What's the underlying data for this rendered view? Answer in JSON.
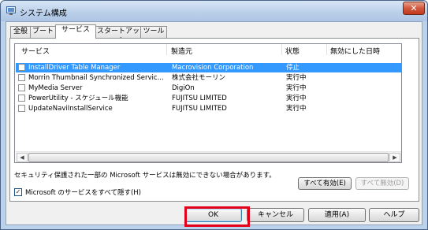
{
  "window": {
    "title": "システム構成",
    "close_symbol": "✕"
  },
  "tabs": [
    {
      "label": "全般"
    },
    {
      "label": "ブート"
    },
    {
      "label": "サービス"
    },
    {
      "label": "スタートアップ"
    },
    {
      "label": "ツール"
    }
  ],
  "active_tab": "サービス",
  "columns": [
    "サービス",
    "製造元",
    "状態",
    "無効にした日時"
  ],
  "services": [
    {
      "name": "InstallDriver Table Manager",
      "maker": "Macrovision Corporation",
      "status": "停止",
      "disabled_date": "",
      "checked": false,
      "selected": true
    },
    {
      "name": "Morrin Thumbnail Synchronized Servic...",
      "maker": "株式会社モーリン",
      "status": "実行中",
      "disabled_date": "",
      "checked": false,
      "selected": false
    },
    {
      "name": "MyMedia Server",
      "maker": "DigiOn",
      "status": "実行中",
      "disabled_date": "",
      "checked": false,
      "selected": false
    },
    {
      "name": "PowerUtility - スケジュール機能",
      "maker": "FUJITSU LIMITED",
      "status": "実行中",
      "disabled_date": "",
      "checked": false,
      "selected": false
    },
    {
      "name": "UpdateNaviInstallService",
      "maker": "FUJITSU LIMITED",
      "status": "実行中",
      "disabled_date": "",
      "checked": false,
      "selected": false
    }
  ],
  "notice": "セキュリティ保護された一部の Microsoft サービスは無効にできない場合があります。",
  "enable_all_label": "すべて有効(E)",
  "disable_all_label": "すべて無効(D)",
  "hide_ms": {
    "label": "Microsoft のサービスをすべて隠す(H)",
    "checked": true
  },
  "footer": {
    "ok": "OK",
    "cancel": "キャンセル",
    "apply": "適用(A)",
    "help": "ヘルプ"
  },
  "colors": {
    "selection": "#3399ff",
    "highlight_box": "#e3001b"
  }
}
